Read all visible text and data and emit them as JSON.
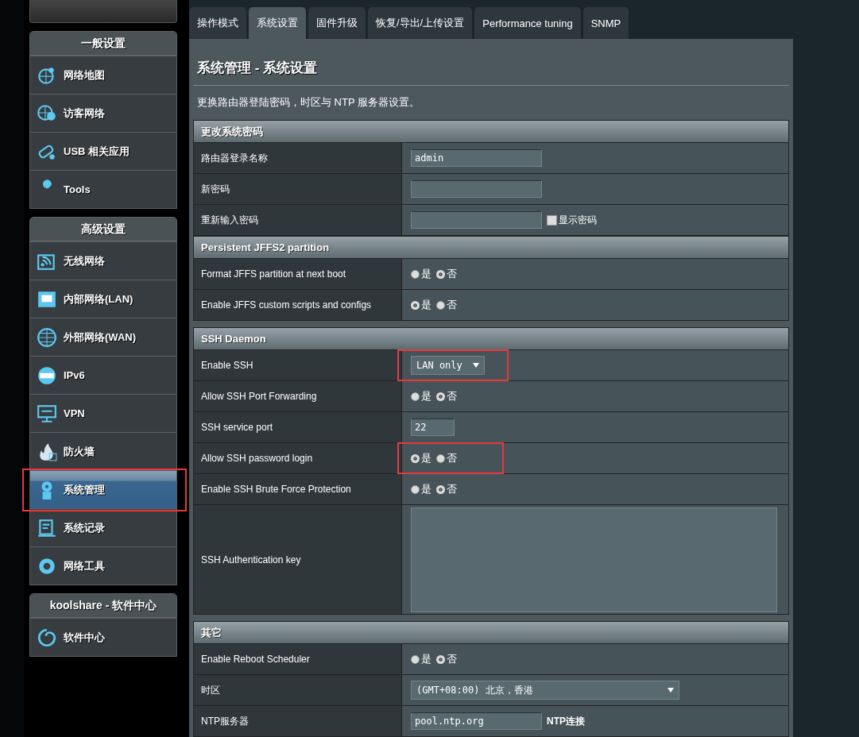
{
  "sidebar": {
    "groups": [
      {
        "title": "一般设置",
        "items": [
          {
            "label": "网络地图",
            "selected": false,
            "highlighted": false
          },
          {
            "label": "访客网络",
            "selected": false,
            "highlighted": false
          },
          {
            "label": "USB 相关应用",
            "selected": false,
            "highlighted": false
          },
          {
            "label": "Tools",
            "selected": false,
            "highlighted": false
          }
        ]
      },
      {
        "title": "高级设置",
        "items": [
          {
            "label": "无线网络",
            "selected": false,
            "highlighted": false
          },
          {
            "label": "内部网络(LAN)",
            "selected": false,
            "highlighted": false
          },
          {
            "label": "外部网络(WAN)",
            "selected": false,
            "highlighted": false
          },
          {
            "label": "IPv6",
            "selected": false,
            "highlighted": false
          },
          {
            "label": "VPN",
            "selected": false,
            "highlighted": false
          },
          {
            "label": "防火墙",
            "selected": false,
            "highlighted": false
          },
          {
            "label": "系统管理",
            "selected": true,
            "highlighted": true
          },
          {
            "label": "系统记录",
            "selected": false,
            "highlighted": false
          },
          {
            "label": "网络工具",
            "selected": false,
            "highlighted": false
          }
        ]
      },
      {
        "title": "koolshare - 软件中心",
        "items": [
          {
            "label": "软件中心",
            "selected": false,
            "highlighted": false
          }
        ]
      }
    ]
  },
  "tabs": [
    {
      "label": "操作模式",
      "selected": false
    },
    {
      "label": "系统设置",
      "selected": true
    },
    {
      "label": "固件升级",
      "selected": false
    },
    {
      "label": "恢复/导出/上传设置",
      "selected": false
    },
    {
      "label": "Performance tuning",
      "selected": false
    },
    {
      "label": "SNMP",
      "selected": false
    }
  ],
  "page": {
    "title": "系统管理 - 系统设置",
    "description": "更换路由器登陆密码，时区与 NTP 服务器设置。"
  },
  "sections": [
    {
      "title": "更改系统密码",
      "rows": [
        {
          "kind": "input",
          "label": "路由器登录名称",
          "value": "admin",
          "highlighted": false
        },
        {
          "kind": "input",
          "label": "新密码",
          "highlighted": false
        },
        {
          "kind": "input",
          "label": "重新输入密码",
          "checkbox": {
            "label": "显示密码",
            "checked": false
          },
          "highlighted": false
        }
      ]
    },
    {
      "title": "Persistent JFFS2 partition",
      "rows": [
        {
          "kind": "radio",
          "label": "Format JFFS partition at next boot",
          "options": [
            {
              "label": "是",
              "selected": false
            },
            {
              "label": "否",
              "selected": true
            }
          ],
          "highlighted": false
        },
        {
          "kind": "radio",
          "label": "Enable JFFS custom scripts and configs",
          "options": [
            {
              "label": "是",
              "selected": true
            },
            {
              "label": "否",
              "selected": false
            }
          ],
          "highlighted": false
        }
      ]
    },
    {
      "title": "SSH Daemon",
      "rows": [
        {
          "kind": "select",
          "label": "Enable SSH",
          "value": "LAN only",
          "highlighted": true
        },
        {
          "kind": "radio",
          "label": "Allow SSH Port Forwarding",
          "options": [
            {
              "label": "是",
              "selected": false
            },
            {
              "label": "否",
              "selected": true
            }
          ],
          "highlighted": false
        },
        {
          "kind": "port",
          "label": "SSH service port",
          "value": "22",
          "highlighted": false
        },
        {
          "kind": "radio",
          "label": "Allow SSH password login",
          "options": [
            {
              "label": "是",
              "selected": true
            },
            {
              "label": "否",
              "selected": false
            }
          ],
          "highlighted": true
        },
        {
          "kind": "radio",
          "label": "Enable SSH Brute Force Protection",
          "options": [
            {
              "label": "是",
              "selected": false
            },
            {
              "label": "否",
              "selected": true
            }
          ],
          "highlighted": false
        },
        {
          "kind": "textarea",
          "label": "SSH Authentication key",
          "highlighted": false
        }
      ]
    },
    {
      "title": "其它",
      "rows": [
        {
          "kind": "radio",
          "label": "Enable Reboot Scheduler",
          "options": [
            {
              "label": "是",
              "selected": false
            },
            {
              "label": "否",
              "selected": true
            }
          ],
          "highlighted": false
        },
        {
          "kind": "wideselect",
          "label": "时区",
          "value": "(GMT+08:00) 北京，香港",
          "highlighted": false
        },
        {
          "kind": "input",
          "label": "NTP服务器",
          "value": "pool.ntp.org",
          "link": "NTP连接",
          "highlighted": false
        }
      ]
    }
  ]
}
